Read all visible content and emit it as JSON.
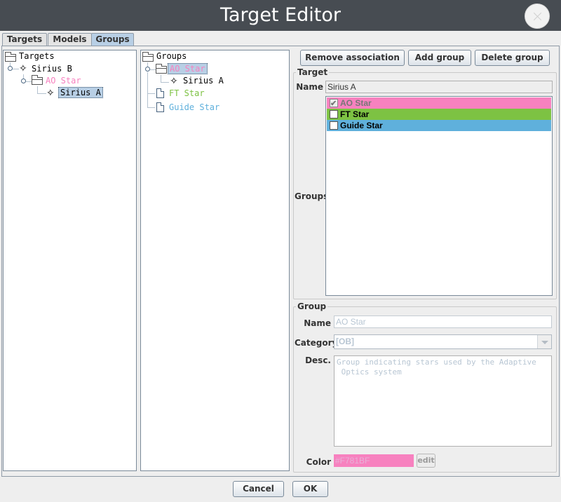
{
  "window": {
    "title": "Target Editor"
  },
  "tabs": [
    {
      "label": "Targets"
    },
    {
      "label": "Models"
    },
    {
      "label": "Groups"
    }
  ],
  "targets_tree": {
    "root": "Targets",
    "nodes": [
      "Sirius B",
      "AO Star",
      "Sirius A"
    ]
  },
  "groups_tree": {
    "root": "Groups",
    "nodes": [
      "AO Star",
      "Sirius A",
      "FT Star",
      "Guide Star"
    ]
  },
  "buttons": {
    "remove_association": "Remove association",
    "add_group": "Add group",
    "delete_group": "Delete group",
    "cancel": "Cancel",
    "ok": "OK",
    "edit": "edit"
  },
  "target_panel": {
    "title": "Target",
    "name_label": "Name",
    "name_value": "Sirius A",
    "groups_label": "Groups",
    "groups": [
      {
        "name": "AO Star",
        "checked": true,
        "color": "#F781BF"
      },
      {
        "name": "FT Star",
        "checked": false,
        "color": "#7DC243"
      },
      {
        "name": "Guide Star",
        "checked": false,
        "color": "#5FB0DC"
      }
    ]
  },
  "group_panel": {
    "title": "Group",
    "name_label": "Name",
    "name_value": "AO Star",
    "category_label": "Category",
    "category_value": "[OB]",
    "desc_label": "Desc.",
    "desc_value": "Group indicating stars used by the Adaptive\n Optics system",
    "color_label": "Color",
    "color_value": "#F781BF"
  },
  "colors": {
    "ao_star": "#F781BF",
    "ft_star": "#7DC243",
    "guide_star": "#5FB0DC",
    "selection": "#B8CFE5"
  }
}
